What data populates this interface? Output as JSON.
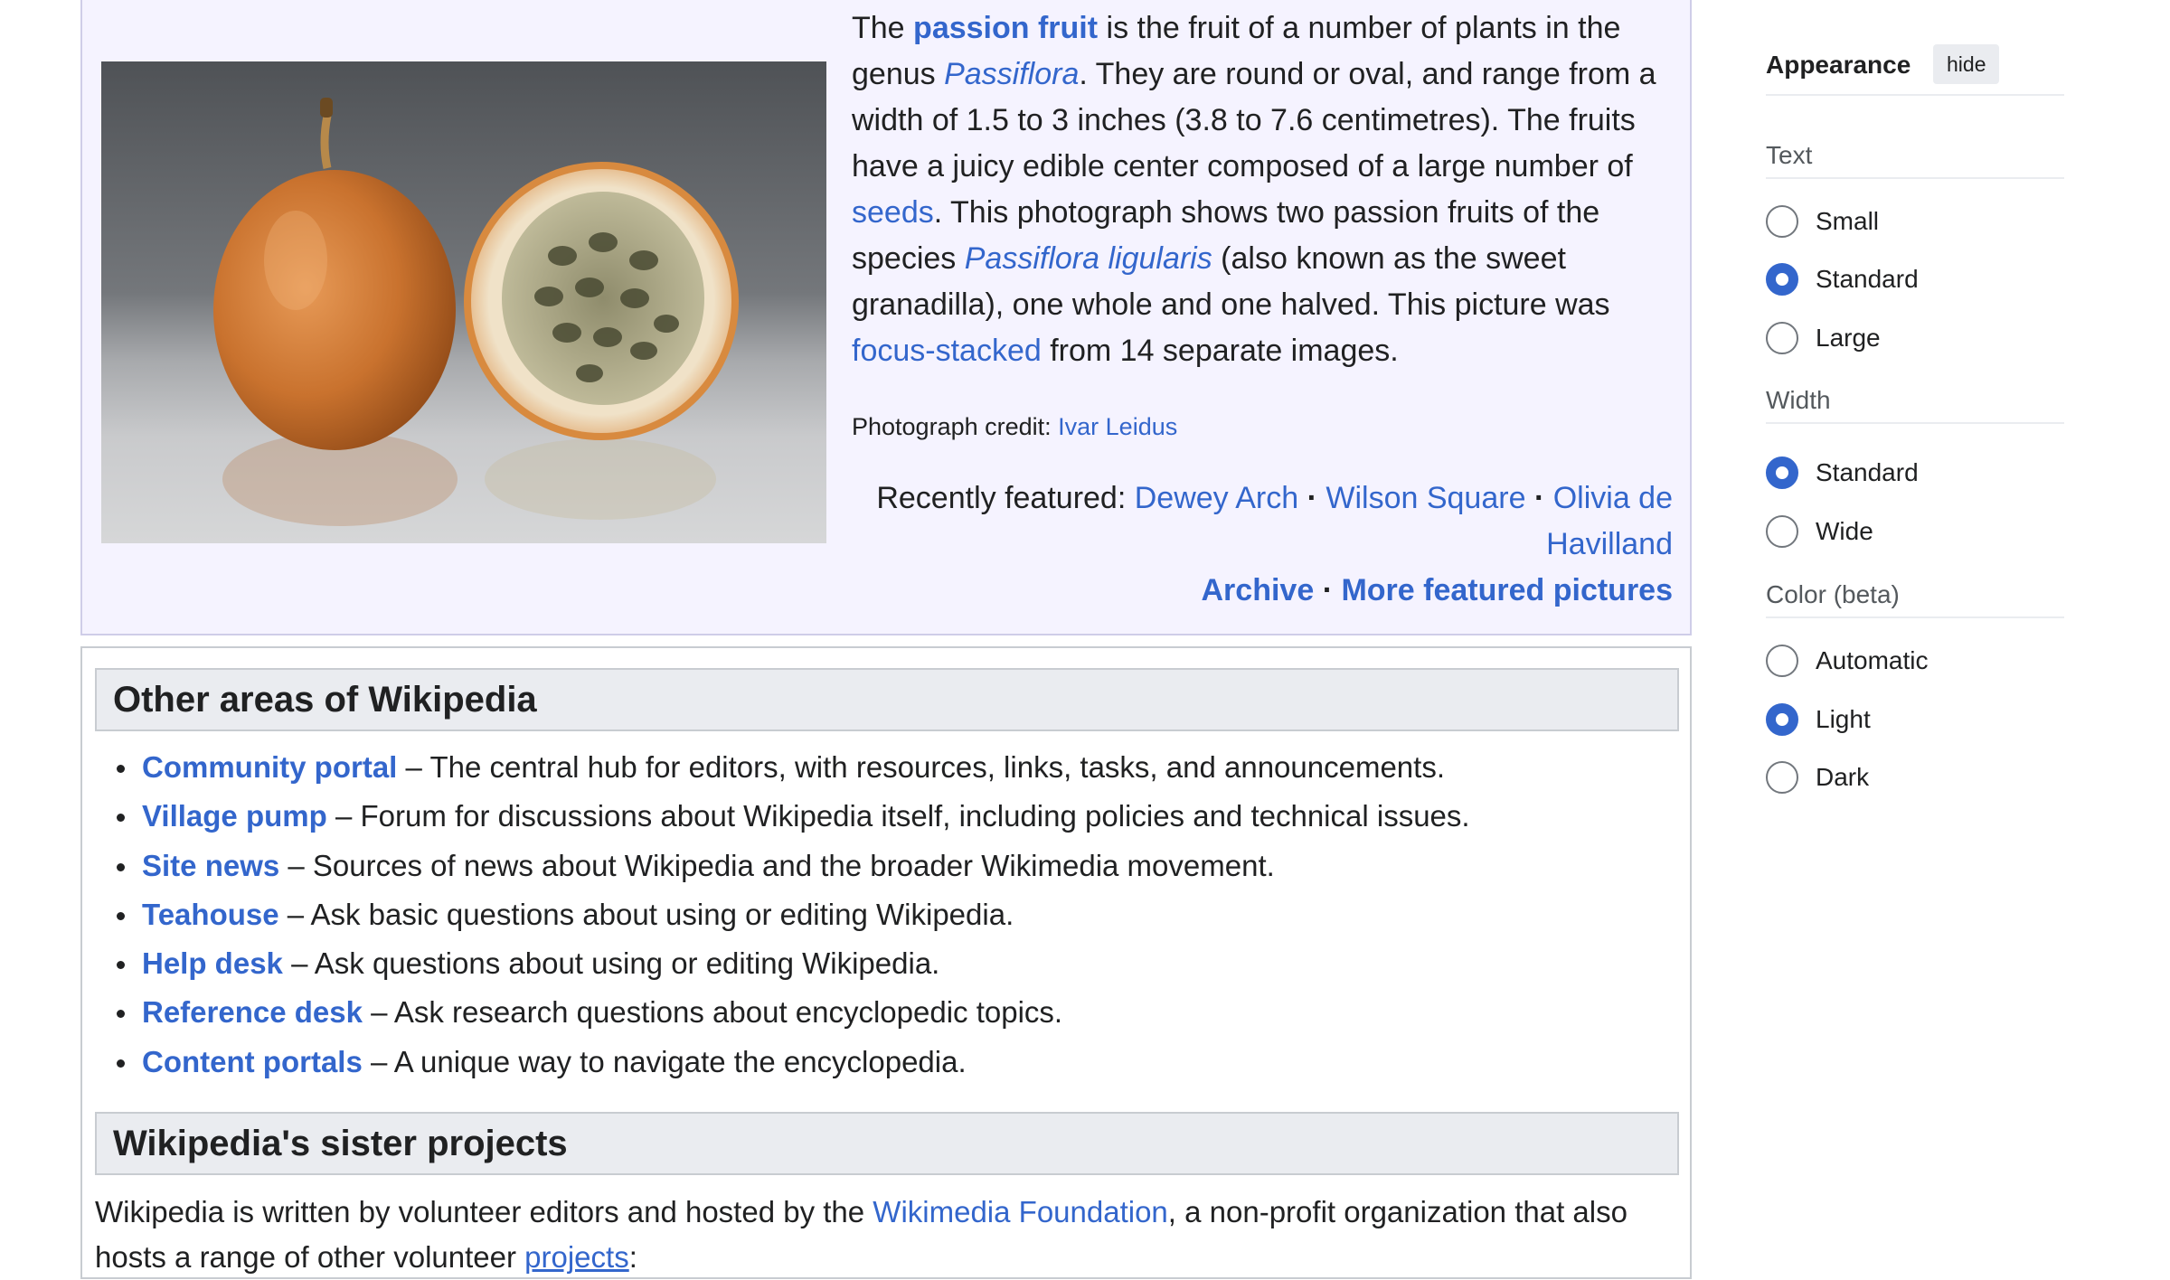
{
  "featured": {
    "intro_lead": "The ",
    "passion_fruit_link": "passion fruit",
    "text_1": " is the fruit of a number of plants in the genus ",
    "passiflora_link": "Passiflora",
    "text_2": ". They are round or oval, and range from a width of 1.5 to 3 inches (3.8 to 7.6 centimetres). The fruits have a juicy edible center composed of a large number of ",
    "seeds_link": "seeds",
    "text_3": ". This photograph shows two passion fruits of the species ",
    "species_link": "Passiflora ligularis",
    "text_4": " (also known as the sweet granadilla), one whole and one halved. This picture was ",
    "focus_stacked_link": "focus-stacked",
    "text_5": " from 14 separate images.",
    "credit_label": "Photograph credit: ",
    "credit_link": "Ivar Leidus",
    "recently_label": "Recently featured: ",
    "recent_items": [
      "Dewey Arch",
      "Wilson Square",
      "Olivia de Havilland"
    ],
    "separator": "·",
    "archive_link": "Archive",
    "more_link": "More featured pictures",
    "image_icon": "passion-fruit-photo"
  },
  "other_areas": {
    "heading": "Other areas of Wikipedia",
    "items": [
      {
        "link": "Community portal",
        "desc": " – The central hub for editors, with resources, links, tasks, and announcements."
      },
      {
        "link": "Village pump",
        "desc": " – Forum for discussions about Wikipedia itself, including policies and technical issues."
      },
      {
        "link": "Site news",
        "desc": " – Sources of news about Wikipedia and the broader Wikimedia movement."
      },
      {
        "link": "Teahouse",
        "desc": " – Ask basic questions about using or editing Wikipedia."
      },
      {
        "link": "Help desk",
        "desc": " – Ask questions about using or editing Wikipedia."
      },
      {
        "link": "Reference desk",
        "desc": " – Ask research questions about encyclopedic topics."
      },
      {
        "link": "Content portals",
        "desc": " – A unique way to navigate the encyclopedia."
      }
    ]
  },
  "sister": {
    "heading": "Wikipedia's sister projects",
    "text_1": "Wikipedia is written by volunteer editors and hosted by the ",
    "foundation_link": "Wikimedia Foundation",
    "text_2": ", a non-profit organization that also hosts a range of other volunteer ",
    "projects_link": "projects",
    "text_3": ":"
  },
  "appearance": {
    "title": "Appearance",
    "hide_label": "hide",
    "text_group": {
      "title": "Text",
      "options": [
        "Small",
        "Standard",
        "Large"
      ],
      "selected": "Standard"
    },
    "width_group": {
      "title": "Width",
      "options": [
        "Standard",
        "Wide"
      ],
      "selected": "Standard"
    },
    "color_group": {
      "title": "Color (beta)",
      "options": [
        "Automatic",
        "Light",
        "Dark"
      ],
      "selected": "Light"
    }
  },
  "colors": {
    "link": "#3366cc",
    "featured_bg": "#f5f3ff",
    "heading_bg": "#eaecf0",
    "radio_checked": "#3366cc"
  }
}
